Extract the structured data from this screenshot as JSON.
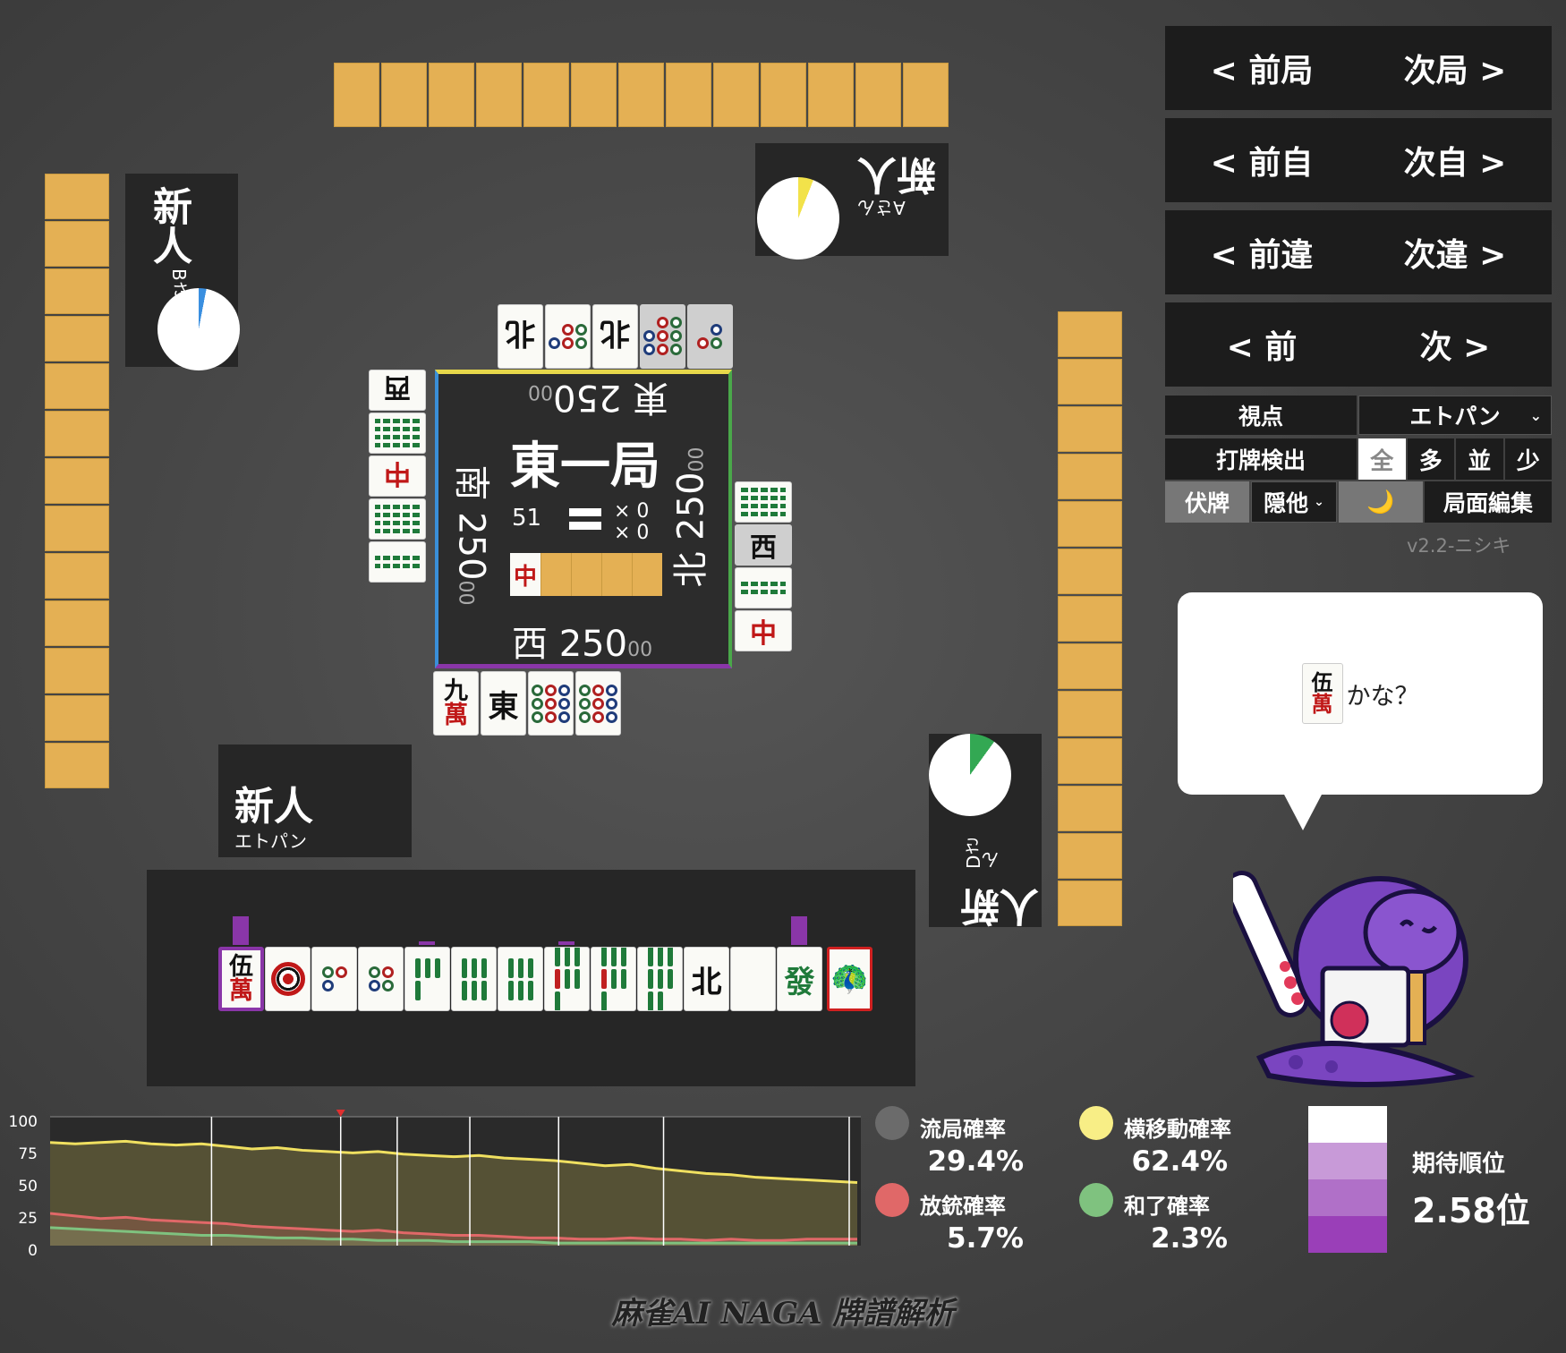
{
  "players": {
    "top": {
      "name": "新人",
      "sub": "Aさん"
    },
    "left": {
      "name": "新人",
      "sub": "Bさん"
    },
    "right": {
      "name": "新人",
      "sub": "Dさん"
    },
    "self": {
      "name": "新人",
      "sub": "エトパン"
    }
  },
  "pie": {
    "top": {
      "fraction": 0.06,
      "color": "#f2e24a"
    },
    "left": {
      "fraction": 0.03,
      "color": "#3a8fe0"
    },
    "right": {
      "fraction": 0.1,
      "color": "#33a853"
    }
  },
  "center": {
    "round": "東一局",
    "tiles_left": "51",
    "honba": "× 0",
    "kyotaku": "× 0",
    "seats": {
      "top": {
        "wind": "東",
        "score": "250",
        "small": "00"
      },
      "left": {
        "wind": "南",
        "score": "250",
        "small": "00"
      },
      "bottom": {
        "wind": "西",
        "score": "250",
        "small": "00"
      },
      "right": {
        "wind": "北",
        "score": "250",
        "small": "00"
      }
    },
    "dora_indicator": "中"
  },
  "discards": {
    "top": [
      "3p",
      "8p",
      "北",
      "5p",
      "北"
    ],
    "left": [
      "西",
      "8s",
      "中",
      "8s",
      "2s"
    ],
    "right": [
      "8s",
      "西",
      "2s",
      "中"
    ],
    "bottom": [
      "九萬",
      "東",
      "9p",
      "9p"
    ]
  },
  "hand": {
    "tiles": [
      "伍萬",
      "1p",
      "3p",
      "4p",
      "4s",
      "6s",
      "6s",
      "7s",
      "7s",
      "8s",
      "北",
      "",
      "發"
    ],
    "draw": "1s"
  },
  "nav": {
    "prev_round": "< 前局",
    "next_round": "次局 >",
    "prev_self": "< 前自",
    "next_self": "次自 >",
    "prev_diff": "< 前違",
    "next_diff": "次違 >",
    "prev": "< 前",
    "next": "次 >"
  },
  "controls": {
    "viewpoint_label": "視点",
    "viewpoint_value": "エトパン",
    "detect_label": "打牌検出",
    "detect_options": [
      "全",
      "多",
      "並",
      "少"
    ],
    "hidden_label": "伏牌",
    "hide_others": "隠他",
    "moon": "🌙",
    "edit": "局面編集",
    "version": "v2.2-ニシキ"
  },
  "bubble": {
    "tile_top": "伍",
    "tile_bottom": "萬",
    "text": "かな？"
  },
  "chart_data": {
    "type": "area",
    "ylim": [
      0,
      100
    ],
    "yticks": [
      "100",
      "75",
      "50",
      "25",
      "0"
    ],
    "series": [
      {
        "name": "横移動確率",
        "color": "#f0e060",
        "values": [
          80,
          79,
          80,
          81,
          79,
          78,
          79,
          77,
          75,
          76,
          74,
          73,
          72,
          73,
          71,
          70,
          69,
          70,
          68,
          67,
          66,
          64,
          62,
          63,
          60,
          58,
          56,
          55,
          53,
          52,
          51,
          50,
          49
        ]
      },
      {
        "name": "放銃確率",
        "color": "#e06868",
        "values": [
          25,
          23,
          21,
          22,
          20,
          19,
          18,
          17,
          15,
          14,
          13,
          12,
          11,
          12,
          10,
          9,
          8,
          8,
          7,
          6,
          6,
          5,
          5,
          6,
          5,
          5,
          4,
          5,
          4,
          4,
          5,
          5,
          5
        ]
      },
      {
        "name": "和了確率",
        "color": "#7fc27f",
        "values": [
          14,
          13,
          12,
          11,
          10,
          9,
          8,
          8,
          7,
          6,
          6,
          5,
          5,
          4,
          4,
          4,
          3,
          3,
          3,
          3,
          2,
          2,
          2,
          2,
          2,
          2,
          2,
          2,
          2,
          2,
          2,
          2,
          2
        ]
      }
    ],
    "vlines": [
      0.2,
      0.36,
      0.43,
      0.52,
      0.63,
      0.76,
      0.99
    ],
    "marker": 0.36
  },
  "probs": {
    "draw": {
      "label": "流局確率",
      "value": "29.4%",
      "color": "#6b6b6b"
    },
    "side": {
      "label": "横移動確率",
      "value": "62.4%",
      "color": "#f8ee86"
    },
    "deal": {
      "label": "放銃確率",
      "value": "5.7%",
      "color": "#e06868"
    },
    "win": {
      "label": "和了確率",
      "value": "2.3%",
      "color": "#7fc27f"
    }
  },
  "expected": {
    "label": "期待順位",
    "value": "2.58位",
    "shades": [
      "#ffffff",
      "#c89ad8",
      "#b070c8",
      "#9a3fb8"
    ]
  },
  "footer": "麻雀AI NAGA 牌譜解析"
}
